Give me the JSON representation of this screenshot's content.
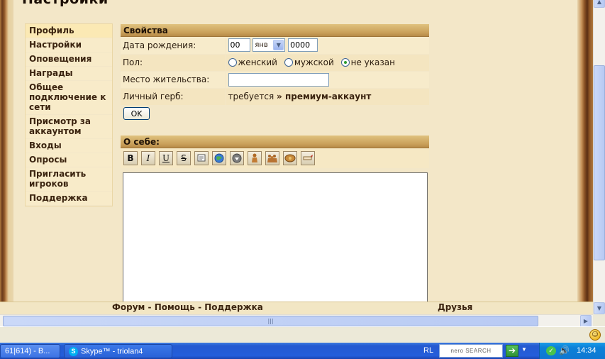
{
  "page": {
    "title": "Настройки"
  },
  "sidebar": {
    "items": [
      {
        "label": "Профиль"
      },
      {
        "label": "Настройки"
      },
      {
        "label": "Оповещения"
      },
      {
        "label": "Награды"
      },
      {
        "label": "Общее подключение к сети"
      },
      {
        "label": "Присмотр за аккаунтом"
      },
      {
        "label": "Входы"
      },
      {
        "label": "Опросы"
      },
      {
        "label": "Пригласить игроков"
      },
      {
        "label": "Поддержка"
      }
    ]
  },
  "properties": {
    "header": "Свойства",
    "birth_date": {
      "label": "Дата рождения:",
      "day": "00",
      "month": "янв",
      "year": "0000"
    },
    "gender": {
      "label": "Пол:",
      "options": [
        "женский",
        "мужской",
        "не указан"
      ],
      "selected": "не указан"
    },
    "residence": {
      "label": "Место жительства:",
      "value": ""
    },
    "coat_of_arms": {
      "label": "Личный герб:",
      "text": "требуется",
      "link": "» премиум-аккаунт"
    },
    "ok_label": "OK"
  },
  "about": {
    "header": "О себе:",
    "toolbar": [
      {
        "label": "B",
        "icon": "bold-icon"
      },
      {
        "label": "I",
        "icon": "italic-icon"
      },
      {
        "label": "U",
        "icon": "underline-icon"
      },
      {
        "label": "S",
        "icon": "strikethrough-icon"
      },
      {
        "label": "",
        "icon": "quote-icon"
      },
      {
        "label": "",
        "icon": "globe-link-icon"
      },
      {
        "label": "",
        "icon": "circle-down-icon"
      },
      {
        "label": "",
        "icon": "person-icon"
      },
      {
        "label": "",
        "icon": "group-icon"
      },
      {
        "label": "",
        "icon": "shield-icon"
      },
      {
        "label": "",
        "icon": "scroll-icon"
      }
    ],
    "text": ""
  },
  "footer": {
    "links": "Форум - Помощь - Поддержка",
    "friends": "Друзья"
  },
  "taskbar": {
    "task1": "61|614) - B...",
    "task2": "Skype™ - triolan4",
    "language": "RL",
    "search_logo": "nero SEARCH",
    "clock": "14:34"
  },
  "colors": {
    "parchment": "#f3e7c8",
    "header_gold": "#c9a05a",
    "frame_wood": "#6b3a1c",
    "text_dark": "#2b1c0e",
    "taskbar_blue": "#245edb"
  }
}
